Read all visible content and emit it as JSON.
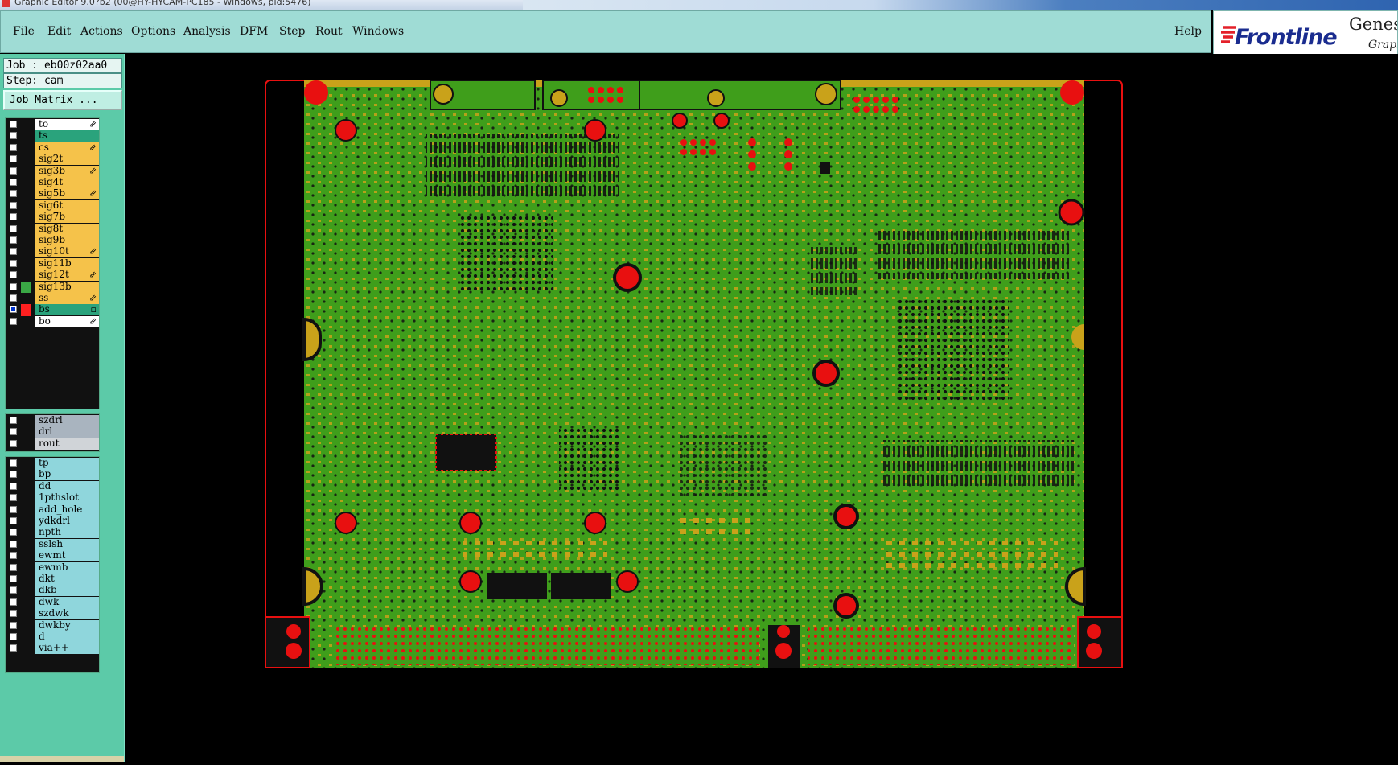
{
  "window": {
    "title": "Graphic Editor 9.0?b2 (00@HY-HYCAM-PC185 - Windows, pid:5476)"
  },
  "menu": {
    "items": [
      "File",
      "Edit",
      "Actions",
      "Options",
      "Analysis",
      "DFM",
      "Step",
      "Rout",
      "Windows"
    ],
    "help": "Help"
  },
  "brand": {
    "name": "Frontline",
    "product": "Genes",
    "subtitle": "Graph"
  },
  "job": {
    "job_line": "Job : eb00z02aa0",
    "step_line": "Step: cam",
    "matrix_button": "Job Matrix ..."
  },
  "layers": {
    "board": [
      {
        "name": "to",
        "color": "#ffffff",
        "checked": false,
        "swatch": "#111111",
        "marker": "⇙"
      },
      {
        "name": "ts",
        "color": "#2aa37c",
        "checked": false,
        "swatch": "#111111",
        "marker": ""
      },
      {
        "name": "cs",
        "color": "#f5c24a",
        "checked": false,
        "swatch": "#111111",
        "marker": "⇙"
      },
      {
        "name": "sig2t",
        "color": "#f5c24a",
        "checked": false,
        "swatch": "#111111",
        "marker": ""
      },
      {
        "name": "sig3b",
        "color": "#f5c24a",
        "checked": false,
        "swatch": "#111111",
        "marker": "⇙"
      },
      {
        "name": "sig4t",
        "color": "#f5c24a",
        "checked": false,
        "swatch": "#111111",
        "marker": ""
      },
      {
        "name": "sig5b",
        "color": "#f5c24a",
        "checked": false,
        "swatch": "#111111",
        "marker": "⇙"
      },
      {
        "name": "sig6t",
        "color": "#f5c24a",
        "checked": false,
        "swatch": "#111111",
        "marker": ""
      },
      {
        "name": "sig7b",
        "color": "#f5c24a",
        "checked": false,
        "swatch": "#111111",
        "marker": ""
      },
      {
        "name": "sig8t",
        "color": "#f5c24a",
        "checked": false,
        "swatch": "#111111",
        "marker": ""
      },
      {
        "name": "sig9b",
        "color": "#f5c24a",
        "checked": false,
        "swatch": "#111111",
        "marker": ""
      },
      {
        "name": "sig10t",
        "color": "#f5c24a",
        "checked": false,
        "swatch": "#111111",
        "marker": "⇙"
      },
      {
        "name": "sig11b",
        "color": "#f5c24a",
        "checked": false,
        "swatch": "#111111",
        "marker": ""
      },
      {
        "name": "sig12t",
        "color": "#f5c24a",
        "checked": false,
        "swatch": "#111111",
        "marker": "⇙"
      },
      {
        "name": "sig13b",
        "color": "#f5c24a",
        "checked": false,
        "swatch": "#3aa845",
        "marker": ""
      },
      {
        "name": "ss",
        "color": "#f5c24a",
        "checked": false,
        "swatch": "#111111",
        "marker": "⇙"
      },
      {
        "name": "bs",
        "color": "#2aa37c",
        "checked": true,
        "swatch": "#ff2020",
        "marker": "▫"
      },
      {
        "name": "bo",
        "color": "#ffffff",
        "checked": false,
        "swatch": "#111111",
        "marker": "⇙"
      }
    ],
    "drill": [
      {
        "name": "szdrl",
        "color": "#a9b4bf",
        "checked": false,
        "swatch": "#111111",
        "marker": ""
      },
      {
        "name": "drl",
        "color": "#a9b4bf",
        "checked": false,
        "swatch": "#111111",
        "marker": ""
      },
      {
        "name": "rout",
        "color": "#d0d4d8",
        "checked": false,
        "swatch": "#111111",
        "marker": ""
      }
    ],
    "misc": [
      {
        "name": "tp",
        "color": "#8fd6dc",
        "checked": false,
        "swatch": "#111111",
        "marker": ""
      },
      {
        "name": "bp",
        "color": "#8fd6dc",
        "checked": false,
        "swatch": "#111111",
        "marker": ""
      },
      {
        "name": "dd",
        "color": "#8fd6dc",
        "checked": false,
        "swatch": "#111111",
        "marker": ""
      },
      {
        "name": "1pthslot",
        "color": "#8fd6dc",
        "checked": false,
        "swatch": "#111111",
        "marker": ""
      },
      {
        "name": "add_hole",
        "color": "#8fd6dc",
        "checked": false,
        "swatch": "#111111",
        "marker": ""
      },
      {
        "name": "ydkdrl",
        "color": "#8fd6dc",
        "checked": false,
        "swatch": "#111111",
        "marker": ""
      },
      {
        "name": "npth",
        "color": "#8fd6dc",
        "checked": false,
        "swatch": "#111111",
        "marker": ""
      },
      {
        "name": "sslsh",
        "color": "#8fd6dc",
        "checked": false,
        "swatch": "#111111",
        "marker": ""
      },
      {
        "name": "ewmt",
        "color": "#8fd6dc",
        "checked": false,
        "swatch": "#111111",
        "marker": ""
      },
      {
        "name": "ewmb",
        "color": "#8fd6dc",
        "checked": false,
        "swatch": "#111111",
        "marker": ""
      },
      {
        "name": "dkt",
        "color": "#8fd6dc",
        "checked": false,
        "swatch": "#111111",
        "marker": ""
      },
      {
        "name": "dkb",
        "color": "#8fd6dc",
        "checked": false,
        "swatch": "#111111",
        "marker": ""
      },
      {
        "name": "dwk",
        "color": "#8fd6dc",
        "checked": false,
        "swatch": "#111111",
        "marker": ""
      },
      {
        "name": "szdwk",
        "color": "#8fd6dc",
        "checked": false,
        "swatch": "#111111",
        "marker": ""
      },
      {
        "name": "dwkby",
        "color": "#8fd6dc",
        "checked": false,
        "swatch": "#111111",
        "marker": ""
      },
      {
        "name": "d",
        "color": "#8fd6dc",
        "checked": false,
        "swatch": "#111111",
        "marker": ""
      },
      {
        "name": "via++",
        "color": "#8fd6dc",
        "checked": false,
        "swatch": "#111111",
        "marker": ""
      }
    ]
  },
  "colors": {
    "board_green": "#3f9e1b",
    "copper_pad": "#c9a21a",
    "mounting_hole": "#ff1010",
    "outline": "#e81010",
    "dark_feature": "#101010"
  }
}
